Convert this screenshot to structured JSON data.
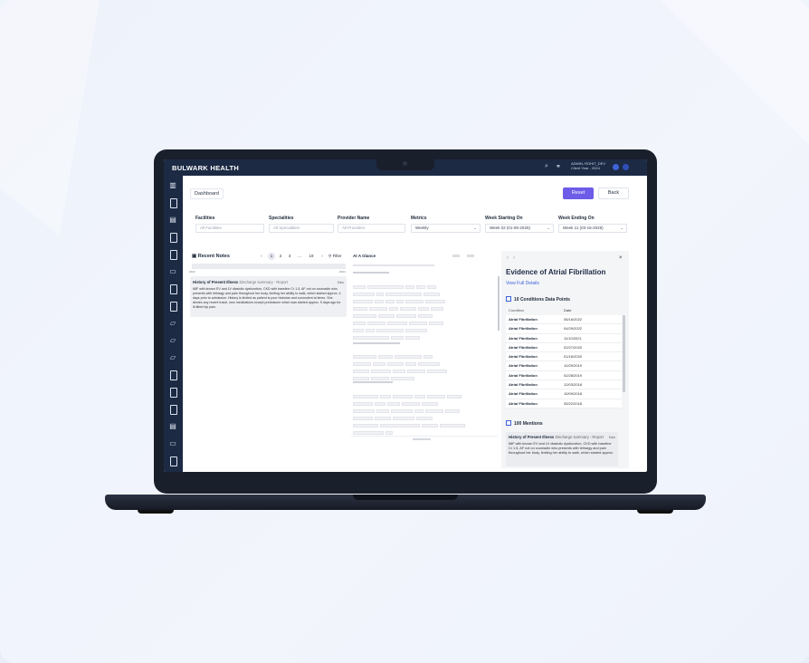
{
  "app": {
    "brand": "BULWARK HEALTH",
    "user_line1": "ADMIN, ROHIT_DEV",
    "user_line2": "Client Year - 2024"
  },
  "header": {
    "breadcrumb": "Dashboard",
    "reset_label": "Reset",
    "back_label": "Back"
  },
  "filters": [
    {
      "label": "Facilities",
      "value": "All Facilities",
      "selected": false
    },
    {
      "label": "Specialities",
      "value": "All Specialities",
      "selected": false
    },
    {
      "label": "Provider Name",
      "value": "All Providers",
      "selected": false
    },
    {
      "label": "Metrics",
      "value": "Weekly",
      "selected": true
    },
    {
      "label": "Week Starting On",
      "value": "Week 02 (01-08-2025)",
      "selected": true
    },
    {
      "label": "Week Ending On",
      "value": "Week 11 (03-16-2025)",
      "selected": true
    }
  ],
  "recent_notes": {
    "title": "Recent Notes",
    "pages": [
      "1",
      "2",
      "3",
      "...",
      "19"
    ],
    "filter_label": "Filter",
    "year_start": "2022",
    "year_end": "2024",
    "note": {
      "heading": "History of Present Illness",
      "subheading": "Discharge summary - Report",
      "date": "Dec",
      "body": "68F with known EV and LV diastolic dysfunction, CKD with baseline Cr 1.5, AF not on coumadin who presents with lethargy and pain throughout her body, limiting her ability to walk, which started approx. 4 days prior to admission. History is limited as patient is poor historian and somnolent at times. She denies any recent travel, new medications except prednisone which was started approx. 5 days ago for ill-fitted hip pain."
    }
  },
  "at_a_glance": {
    "title": "At A Glance"
  },
  "evidence": {
    "title": "Evidence of Atrial Fibrillation",
    "view_full": "View Full Details",
    "data_points_heading": "10 Conditions Data Points",
    "columns": [
      "Condition",
      "Date"
    ],
    "rows": [
      [
        "Atrial Fibrillation",
        "05/16/2022"
      ],
      [
        "Atrial Fibrillation",
        "04/29/2022"
      ],
      [
        "Atrial Fibrillation",
        "11/10/2021"
      ],
      [
        "Atrial Fibrillation",
        "02/27/2020"
      ],
      [
        "Atrial Fibrillation",
        "01/16/2020"
      ],
      [
        "Atrial Fibrillation",
        "10/29/2019"
      ],
      [
        "Atrial Fibrillation",
        "02/28/2019"
      ],
      [
        "Atrial Fibrillation",
        "12/03/2018"
      ],
      [
        "Atrial Fibrillation",
        "10/09/2018"
      ],
      [
        "Atrial Fibrillation",
        "05/22/2018"
      ]
    ],
    "mentions_heading": "100 Mentions",
    "mention": {
      "heading": "History of Present Illness",
      "subheading": "Discharge summary - Report",
      "date": "Dec",
      "body": "68F with known EV and LV diastolic dysfunction, CKD with baseline Cr 1.5, AF not on coumadin who presents with lethargy and pain throughout her body, limiting her ability to walk, which started approx."
    }
  }
}
